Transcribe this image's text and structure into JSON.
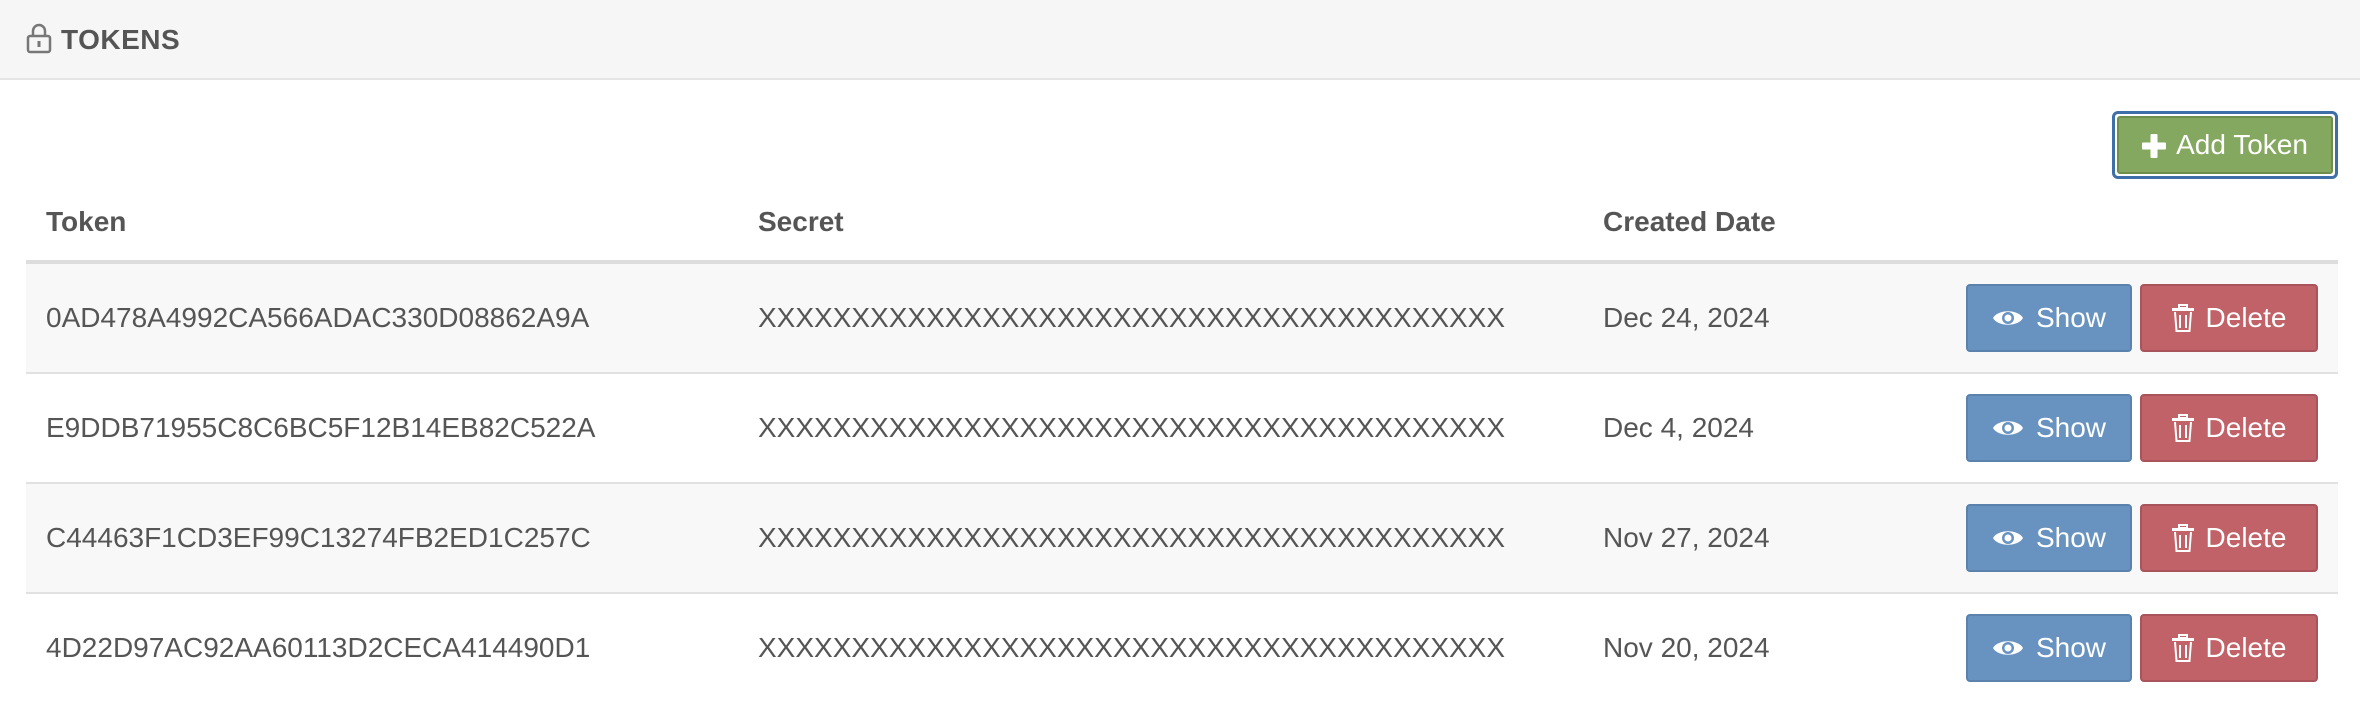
{
  "header": {
    "title": "TOKENS",
    "icon": "lock-icon"
  },
  "actions": {
    "add_label": "Add Token",
    "add_icon": "plus-icon",
    "add_color": "#85a860"
  },
  "table": {
    "columns": [
      "Token",
      "Secret",
      "Created Date"
    ],
    "show_label": "Show",
    "delete_label": "Delete",
    "show_color": "#6893c1",
    "delete_color": "#c06267",
    "rows": [
      {
        "token": "0AD478A4992CA566ADAC330D08862A9A",
        "secret": "XXXXXXXXXXXXXXXXXXXXXXXXXXXXXXXXXXXXXXXX",
        "created": "Dec 24, 2024"
      },
      {
        "token": "E9DDB71955C8C6BC5F12B14EB82C522A",
        "secret": "XXXXXXXXXXXXXXXXXXXXXXXXXXXXXXXXXXXXXXXX",
        "created": "Dec 4, 2024"
      },
      {
        "token": "C44463F1CD3EF99C13274FB2ED1C257C",
        "secret": "XXXXXXXXXXXXXXXXXXXXXXXXXXXXXXXXXXXXXXXX",
        "created": "Nov 27, 2024"
      },
      {
        "token": "4D22D97AC92AA60113D2CECA414490D1",
        "secret": "XXXXXXXXXXXXXXXXXXXXXXXXXXXXXXXXXXXXXXXX",
        "created": "Nov 20, 2024"
      }
    ]
  }
}
